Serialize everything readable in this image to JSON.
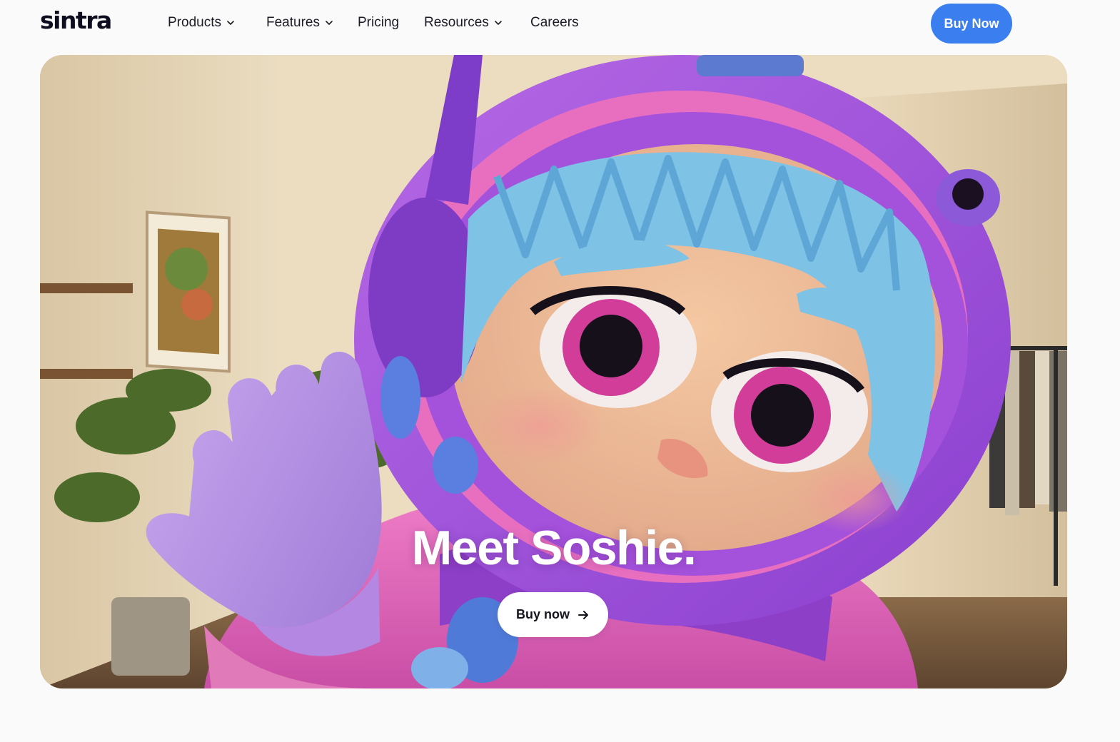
{
  "brand": {
    "logo_text": "sintra"
  },
  "nav": {
    "items": [
      {
        "label": "Products",
        "has_dropdown": true
      },
      {
        "label": "Features",
        "has_dropdown": true
      },
      {
        "label": "Pricing",
        "has_dropdown": false
      },
      {
        "label": "Resources",
        "has_dropdown": true
      },
      {
        "label": "Careers",
        "has_dropdown": false
      }
    ],
    "cta_label": "Buy Now"
  },
  "hero": {
    "title": "Meet Soshie.",
    "cta_label": "Buy now",
    "cta_icon": "arrow-right-icon",
    "image_subject": "soshie-character-illustration"
  },
  "colors": {
    "accent_blue": "#3a7ef0",
    "page_bg": "#fafafa",
    "helmet_purple": "#9b4fd8",
    "hair_blue": "#7ec2e6"
  }
}
